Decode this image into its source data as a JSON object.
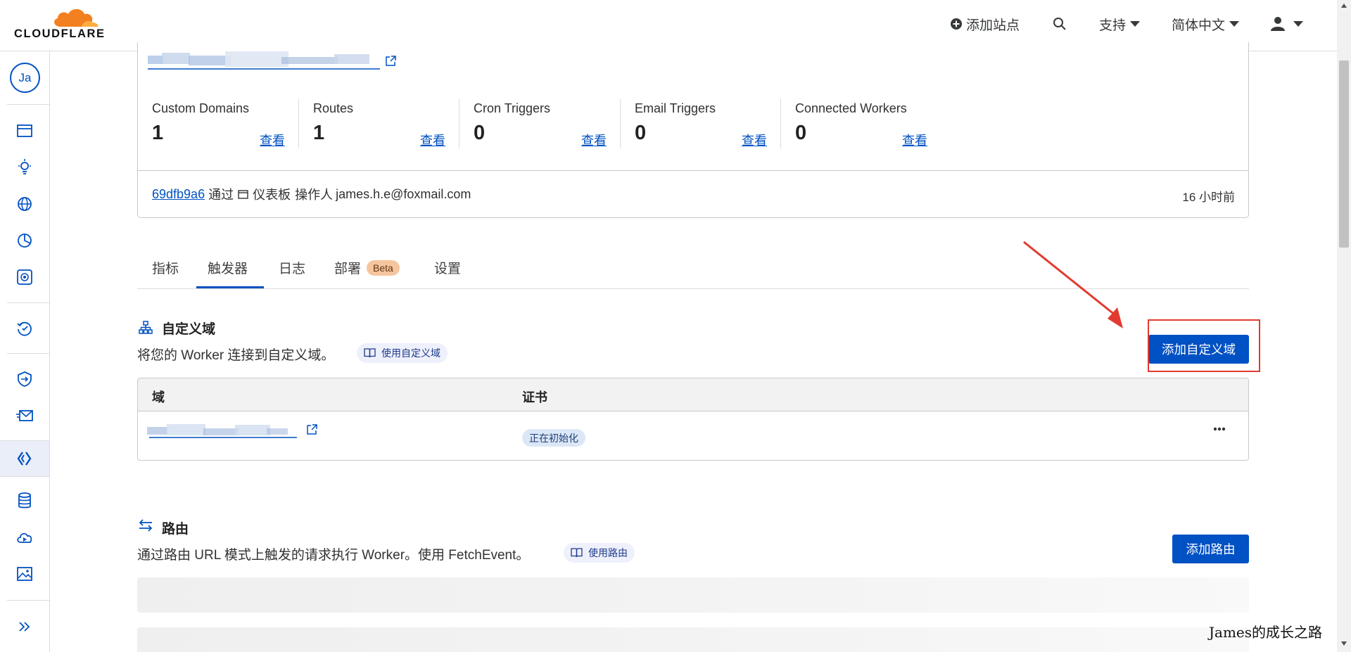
{
  "header": {
    "logo_text": "CLOUDFLARE",
    "add_site": "添加站点",
    "support": "支持",
    "language": "简体中文"
  },
  "sidebar": {
    "avatar_initials": "Ja"
  },
  "worker_summary": {
    "stats": [
      {
        "label": "Custom Domains",
        "value": "1",
        "link": "查看"
      },
      {
        "label": "Routes",
        "value": "1",
        "link": "查看"
      },
      {
        "label": "Cron Triggers",
        "value": "0",
        "link": "查看"
      },
      {
        "label": "Email Triggers",
        "value": "0",
        "link": "查看"
      },
      {
        "label": "Connected Workers",
        "value": "0",
        "link": "查看"
      }
    ],
    "commit": {
      "hash": "69dfb9a6",
      "via": "通过",
      "source": "仪表板",
      "operator_label": "操作人",
      "operator": "james.h.e@foxmail.com",
      "time_ago": "16 小时前"
    }
  },
  "tabs": [
    {
      "label": "指标"
    },
    {
      "label": "触发器",
      "active": true
    },
    {
      "label": "日志"
    },
    {
      "label": "部署",
      "badge": "Beta"
    },
    {
      "label": "设置"
    }
  ],
  "custom_domains": {
    "title": "自定义域",
    "description": "将您的 Worker 连接到自定义域。",
    "doc_link": "使用自定义域",
    "add_button": "添加自定义域",
    "columns": [
      "域",
      "证书"
    ],
    "rows": [
      {
        "domain": "",
        "certificate_status": "正在初始化"
      }
    ]
  },
  "routes": {
    "title": "路由",
    "description": "通过路由 URL 模式上触发的请求执行 Worker。使用 FetchEvent。",
    "doc_link": "使用路由",
    "add_button": "添加路由"
  },
  "watermark": "James的成长之路",
  "colors": {
    "accent": "#0051c3",
    "annotation_red": "#e23a2f",
    "beta_badge": "#f6c59e",
    "cloud_orange": "#f38020"
  }
}
